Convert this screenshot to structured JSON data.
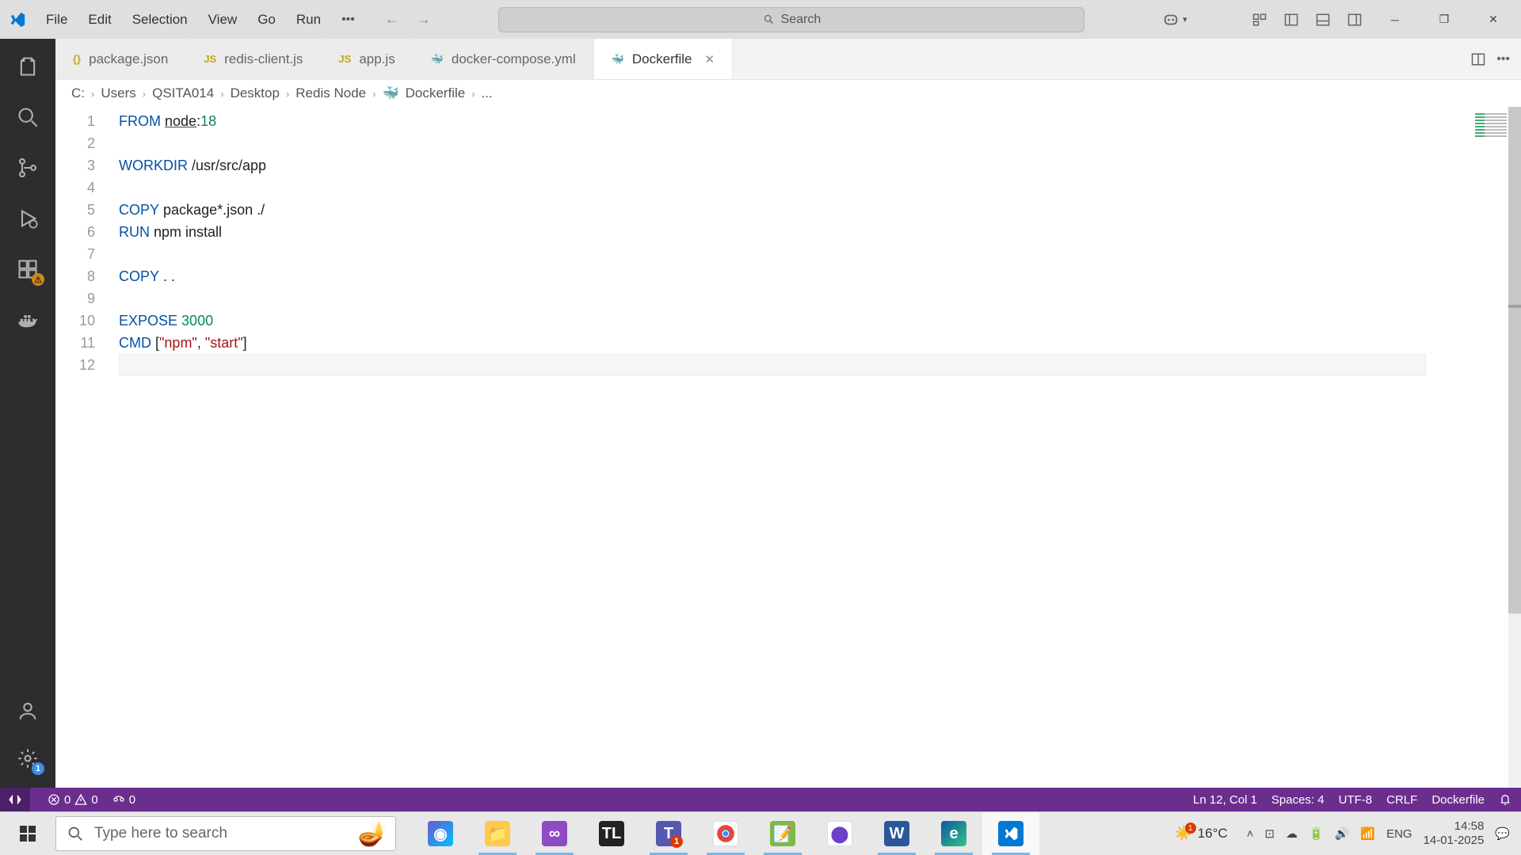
{
  "titlebar": {
    "menu": [
      "File",
      "Edit",
      "Selection",
      "View",
      "Go",
      "Run"
    ],
    "search_placeholder": "Search"
  },
  "tabs": [
    {
      "icon": "{}",
      "iconcolor": "#c8a415",
      "label": "package.json"
    },
    {
      "icon": "JS",
      "iconcolor": "#c8a415",
      "label": "redis-client.js"
    },
    {
      "icon": "JS",
      "iconcolor": "#c8a415",
      "label": "app.js"
    },
    {
      "icon": "🐳",
      "iconcolor": "#e05d8c",
      "label": "docker-compose.yml"
    },
    {
      "icon": "🐳",
      "iconcolor": "#0db7ed",
      "label": "Dockerfile",
      "active": true,
      "close": true
    }
  ],
  "breadcrumbs": [
    "C:",
    "Users",
    "QSITA014",
    "Desktop",
    "Redis Node",
    "Dockerfile",
    "..."
  ],
  "code": {
    "lines": [
      {
        "n": 1,
        "segs": [
          [
            "kw",
            "FROM"
          ],
          [
            "sp",
            " "
          ],
          [
            "id under",
            "node"
          ],
          [
            "id",
            ":"
          ],
          [
            "num",
            "18"
          ]
        ]
      },
      {
        "n": 2,
        "segs": []
      },
      {
        "n": 3,
        "segs": [
          [
            "kw",
            "WORKDIR"
          ],
          [
            "sp",
            " "
          ],
          [
            "id",
            "/usr/src/app"
          ]
        ]
      },
      {
        "n": 4,
        "segs": []
      },
      {
        "n": 5,
        "segs": [
          [
            "kw",
            "COPY"
          ],
          [
            "sp",
            " "
          ],
          [
            "id",
            "package*.json ./"
          ]
        ]
      },
      {
        "n": 6,
        "segs": [
          [
            "kw",
            "RUN"
          ],
          [
            "sp",
            " "
          ],
          [
            "id",
            "npm install"
          ]
        ]
      },
      {
        "n": 7,
        "segs": []
      },
      {
        "n": 8,
        "segs": [
          [
            "kw",
            "COPY"
          ],
          [
            "sp",
            " "
          ],
          [
            "id",
            ". ."
          ]
        ]
      },
      {
        "n": 9,
        "segs": []
      },
      {
        "n": 10,
        "segs": [
          [
            "kw",
            "EXPOSE"
          ],
          [
            "sp",
            " "
          ],
          [
            "num",
            "3000"
          ]
        ]
      },
      {
        "n": 11,
        "segs": [
          [
            "kw",
            "CMD"
          ],
          [
            "sp",
            " "
          ],
          [
            "id",
            "["
          ],
          [
            "str",
            "\"npm\""
          ],
          [
            "id",
            ", "
          ],
          [
            "str",
            "\"start\""
          ],
          [
            "id",
            "]"
          ]
        ]
      },
      {
        "n": 12,
        "segs": [],
        "current": true
      }
    ]
  },
  "statusbar": {
    "errors": "0",
    "warnings": "0",
    "ports": "0",
    "position": "Ln 12, Col 1",
    "spaces": "Spaces: 4",
    "encoding": "UTF-8",
    "eol": "CRLF",
    "lang": "Dockerfile"
  },
  "taskbar": {
    "search_placeholder": "Type here to search",
    "weather": "16°C",
    "lang": "ENG",
    "time": "14:58",
    "date": "14-01-2025"
  },
  "activitybar": {
    "ext_badge": "⚠",
    "settings_badge": "1"
  }
}
